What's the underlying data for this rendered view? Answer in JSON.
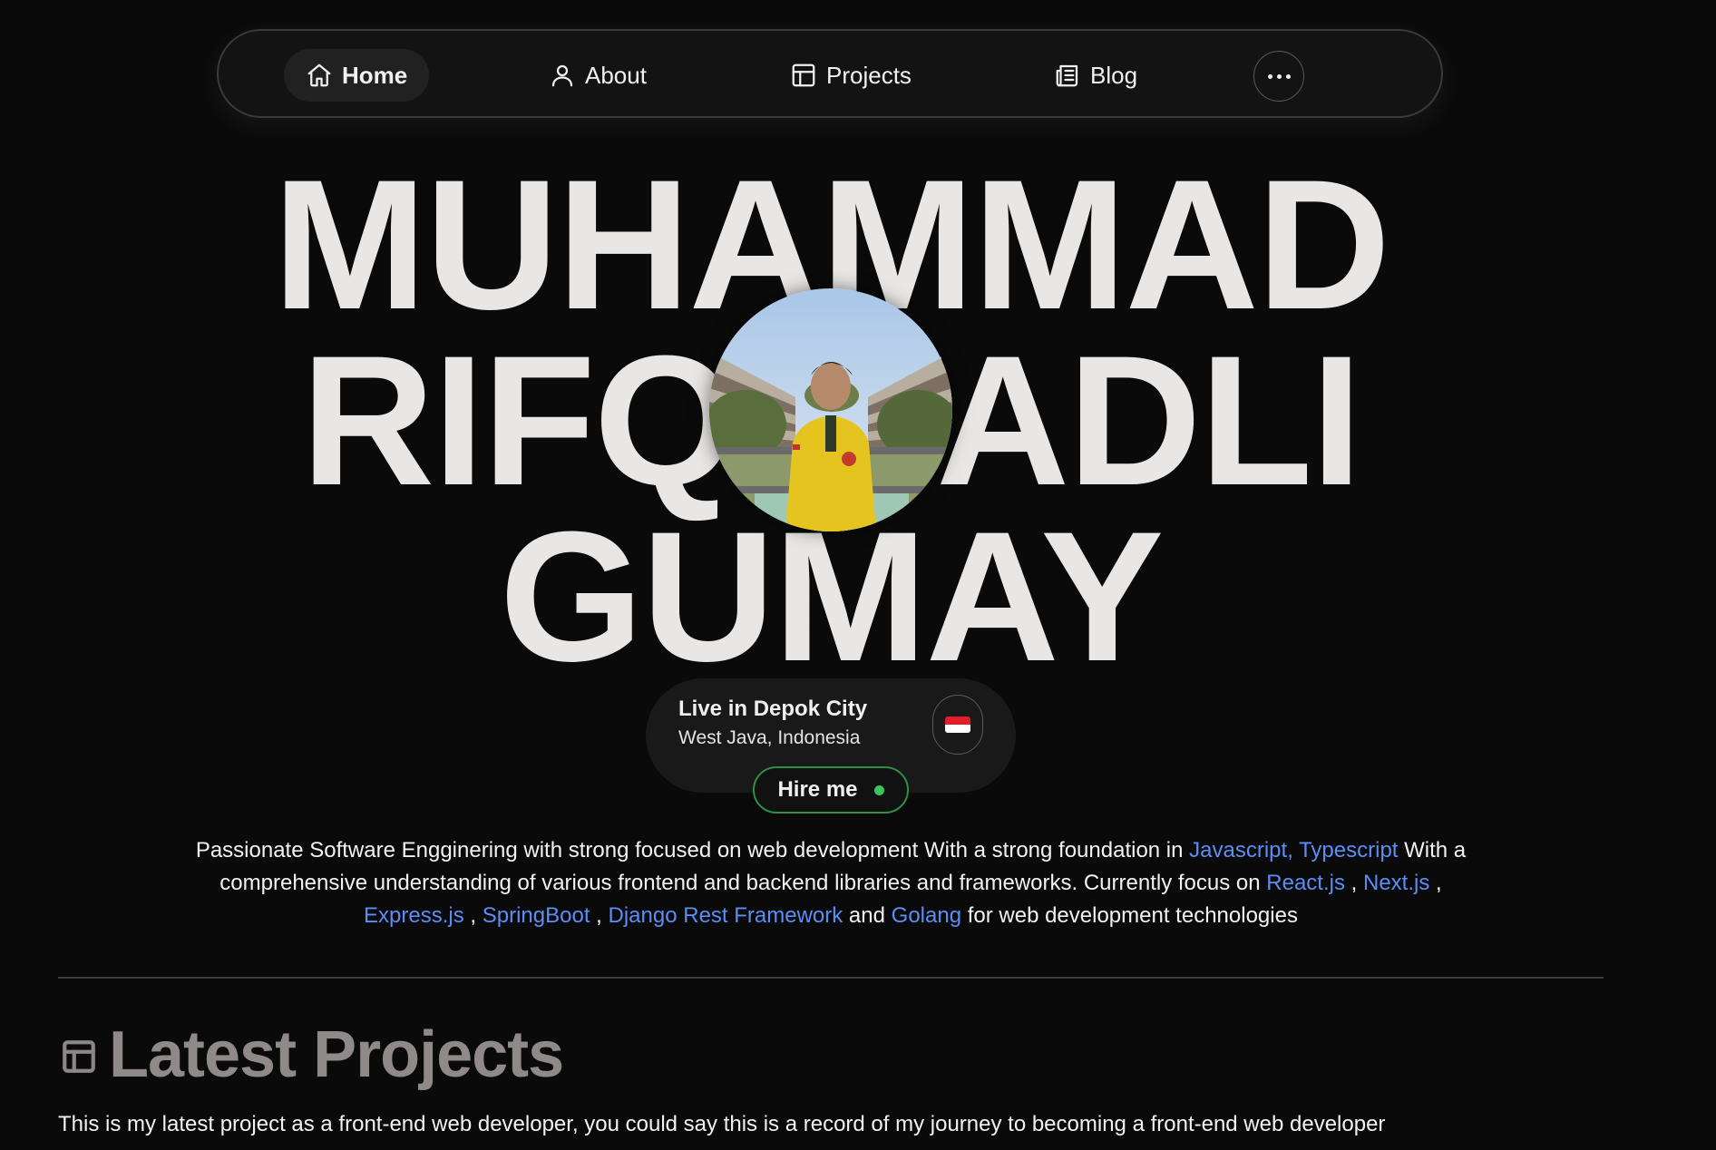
{
  "nav": {
    "items": [
      {
        "label": "Home",
        "icon": "home-icon",
        "active": true
      },
      {
        "label": "About",
        "icon": "user-icon"
      },
      {
        "label": "Projects",
        "icon": "layout-icon"
      },
      {
        "label": "Blog",
        "icon": "newspaper-icon"
      }
    ],
    "more_icon": "more-horizontal-icon"
  },
  "hero": {
    "name_line1": "MUHAMMAD",
    "name_line2": "RIFQI FADLI",
    "name_line3": "GUMAY"
  },
  "location": {
    "city": "Live in Depok City",
    "region": "West Java, Indonesia",
    "flag_icon": "indonesia-flag-icon"
  },
  "hire": {
    "label": "Hire me",
    "status_color": "#39c55b"
  },
  "bio": {
    "t1": "Passionate Software Engginering with strong focused on web development With a strong foundation in ",
    "l1": "Javascript, Typescript",
    "t2": " With a comprehensive understanding of various frontend and backend libraries and frameworks. Currently focus on ",
    "l2": "React.js",
    "s1": " , ",
    "l3": "Next.js",
    "s2": " , ",
    "l4": "Express.js",
    "s3": " , ",
    "l5": "SpringBoot",
    "s4": " , ",
    "l6": "Django Rest Framework",
    "s5": " and ",
    "l7": "Golang",
    "t3": " for web development technologies"
  },
  "projects": {
    "icon": "layout-icon",
    "title": "Latest Projects",
    "description": "This is my latest project as a front-end web developer, you could say this is a record of my journey to becoming a front-end web developer"
  },
  "colors": {
    "background": "#0b0a0a",
    "link": "#5b8df5",
    "hire_border": "#2f8f46"
  }
}
